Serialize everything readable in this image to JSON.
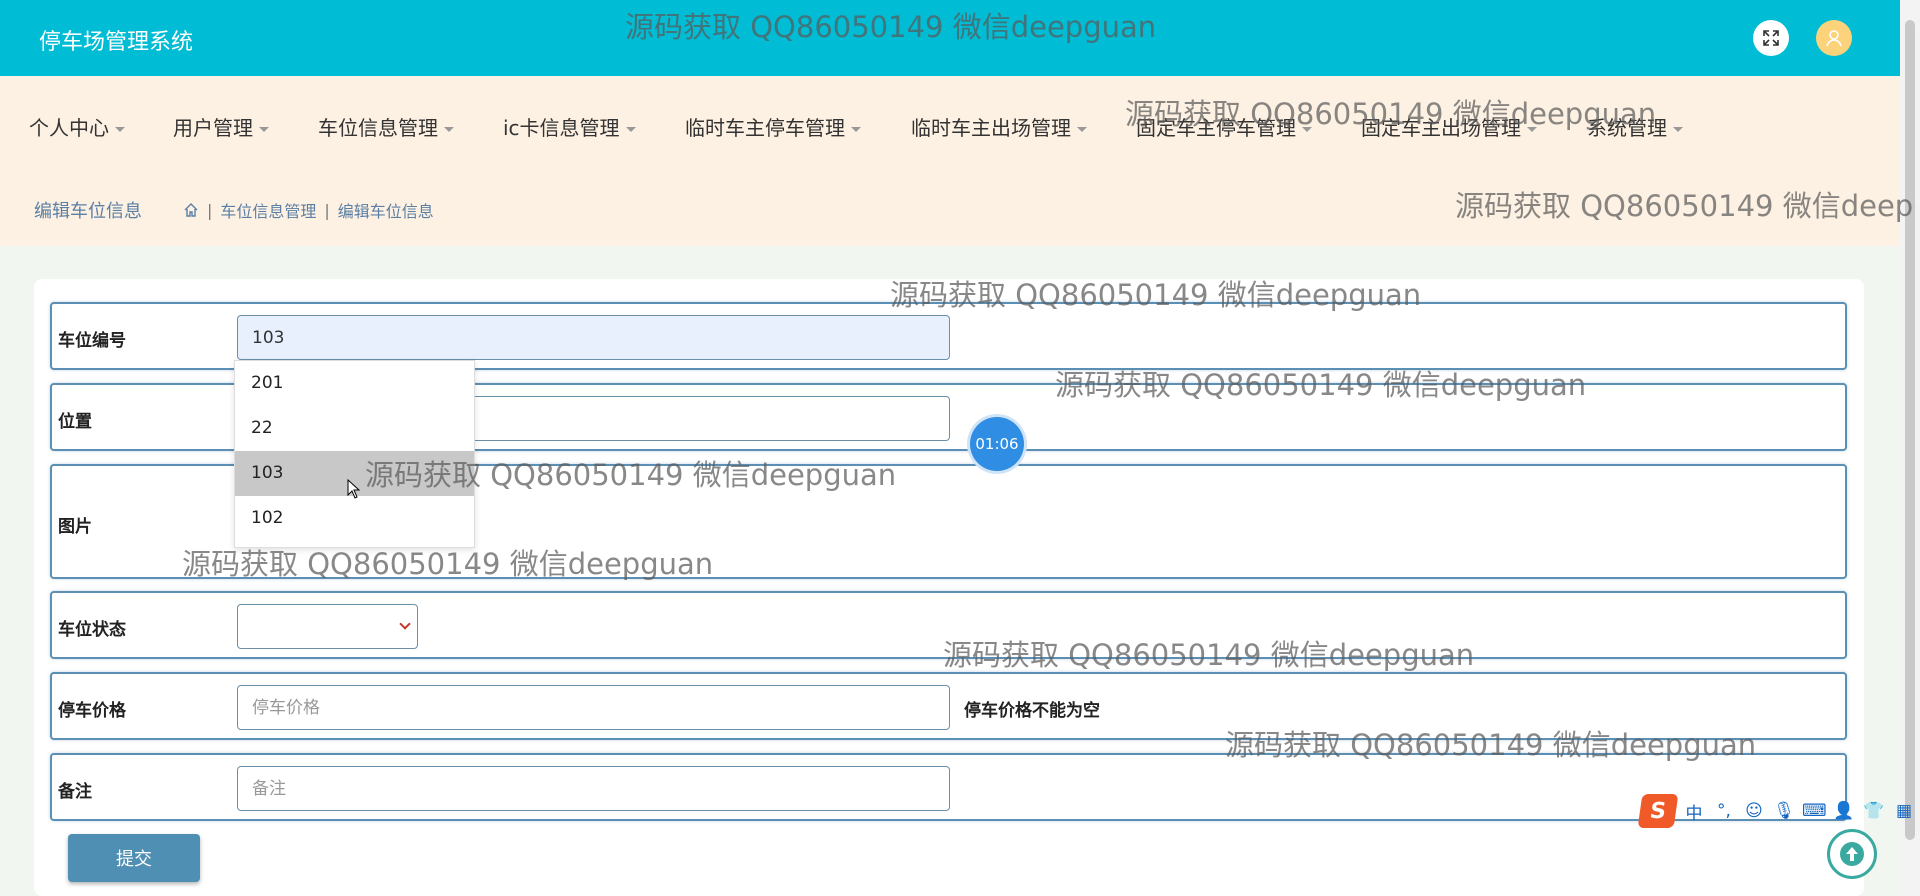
{
  "app": {
    "title": "停车场管理系统"
  },
  "nav": {
    "items": [
      {
        "label": "个人中心"
      },
      {
        "label": "用户管理"
      },
      {
        "label": "车位信息管理"
      },
      {
        "label": "ic卡信息管理"
      },
      {
        "label": "临时车主停车管理"
      },
      {
        "label": "临时车主出场管理"
      },
      {
        "label": "固定车主停车管理"
      },
      {
        "label": "固定车主出场管理"
      },
      {
        "label": "系统管理"
      }
    ]
  },
  "breadcrumb": {
    "title": "编辑车位信息",
    "items": [
      "车位信息管理",
      "编辑车位信息"
    ]
  },
  "form": {
    "parking_no": {
      "label": "车位编号",
      "value": "103"
    },
    "location": {
      "label": "位置",
      "value": ""
    },
    "image": {
      "label": "图片"
    },
    "status": {
      "label": "车位状态",
      "value": ""
    },
    "price": {
      "label": "停车价格",
      "placeholder": "停车价格",
      "error": "停车价格不能为空"
    },
    "remark": {
      "label": "备注",
      "placeholder": "备注"
    },
    "submit_label": "提交"
  },
  "dropdown": {
    "options": [
      "201",
      "22",
      "103",
      "102"
    ],
    "highlighted": "103"
  },
  "timer": {
    "text": "01:06"
  },
  "ime": {
    "mode": "中",
    "punct": "°,"
  },
  "watermark": {
    "text": "源码获取 QQ86050149 微信deepguan"
  },
  "colors": {
    "header": "#00bcd4",
    "nav_bg": "#fdf1e3",
    "accent": "#4f8fb3"
  }
}
